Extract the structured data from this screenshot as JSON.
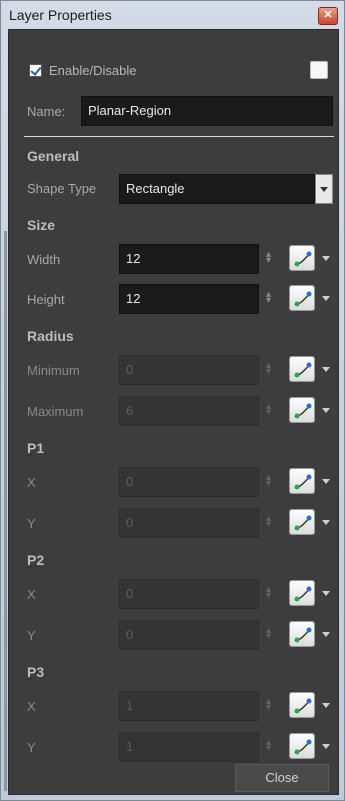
{
  "window": {
    "title": "Layer Properties",
    "close_glyph": "✕"
  },
  "enable": {
    "label": "Enable/Disable",
    "checked": true
  },
  "name": {
    "label": "Name:",
    "value": "Planar-Region"
  },
  "general": {
    "heading": "General",
    "shape_type": {
      "label": "Shape Type",
      "value": "Rectangle"
    }
  },
  "size": {
    "heading": "Size",
    "width": {
      "label": "Width",
      "value": "12"
    },
    "height": {
      "label": "Height",
      "value": "12"
    }
  },
  "radius": {
    "heading": "Radius",
    "minimum": {
      "label": "Minimum",
      "value": "0"
    },
    "maximum": {
      "label": "Maximum",
      "value": "6"
    }
  },
  "p1": {
    "heading": "P1",
    "x": {
      "label": "X",
      "value": "0"
    },
    "y": {
      "label": "Y",
      "value": "0"
    }
  },
  "p2": {
    "heading": "P2",
    "x": {
      "label": "X",
      "value": "0"
    },
    "y": {
      "label": "Y",
      "value": "0"
    }
  },
  "p3": {
    "heading": "P3",
    "x": {
      "label": "X",
      "value": "1"
    },
    "y": {
      "label": "Y",
      "value": "1"
    }
  },
  "footer": {
    "close_label": "Close"
  },
  "icons": {
    "spinner": "spinner-icon",
    "function": "function-curve-icon",
    "dropdown": "chevron-down-icon"
  }
}
